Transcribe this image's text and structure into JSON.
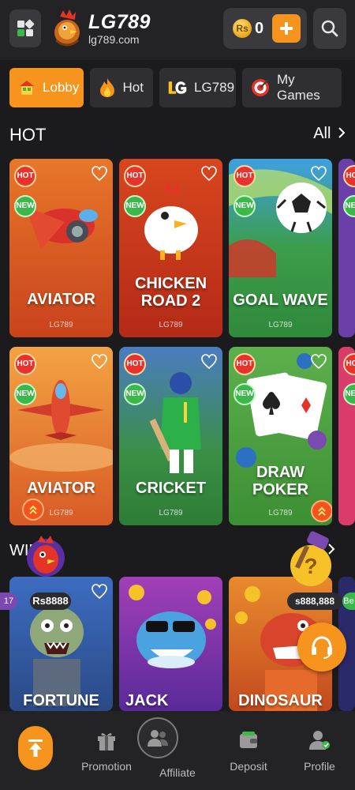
{
  "header": {
    "logo_title": "LG789",
    "logo_url": "lg789.com",
    "balance": "0",
    "coin_symbol": "Rs",
    "add_label": "+"
  },
  "tabs": [
    {
      "label": "Lobby",
      "icon": "lobby-icon",
      "active": true
    },
    {
      "label": "Hot",
      "icon": "fire-icon",
      "active": false
    },
    {
      "label": "LG789",
      "icon": "lg-icon",
      "active": false
    },
    {
      "label": "My Games",
      "icon": "target-icon",
      "active": false
    }
  ],
  "section": {
    "title": "HOT",
    "all_label": "All"
  },
  "badges": {
    "hot": "HOT",
    "new": "NEW"
  },
  "games": [
    {
      "name_line1": "AVIATOR",
      "name_line2": "",
      "provider": "LG789"
    },
    {
      "name_line1": "CHICKEN",
      "name_line2": "ROAD 2",
      "provider": "LG789"
    },
    {
      "name_line1": "GOAL WAVE",
      "name_line2": "",
      "provider": "LG789"
    },
    {
      "name_line1": "AVIATOR",
      "name_line2": "",
      "provider": "LG789"
    },
    {
      "name_line1": "CRICKET",
      "name_line2": "",
      "provider": "LG789"
    },
    {
      "name_line1": "DRAW",
      "name_line2": "POKER",
      "provider": "LG789"
    },
    {
      "name_line1": "FORTUNE",
      "name_line2": "",
      "provider": ""
    },
    {
      "name_line1": "JACK",
      "name_line2": "",
      "provider": ""
    },
    {
      "name_line1": "DINOSAUR",
      "name_line2": "",
      "provider": ""
    }
  ],
  "win_popup": {
    "prefix": "WIN",
    "amount_left": "Rs8888",
    "amount_right": "s888,888",
    "left_tag": "17",
    "right_tag": "Be"
  },
  "bottom_nav": {
    "promotion": "Promotion",
    "affiliate": "Affiliate",
    "deposit": "Deposit",
    "profile": "Profile"
  },
  "colors": {
    "accent": "#f7941d",
    "hot": "#e8322b",
    "new": "#3bb84a"
  }
}
